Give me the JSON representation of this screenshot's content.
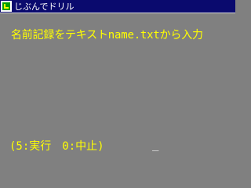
{
  "window": {
    "title": "じぶんでドリル"
  },
  "icons": {
    "app": "app-logo-icon"
  },
  "colors": {
    "background": "#808080",
    "titlebar": "#0a0a6e",
    "text": "#ffff00",
    "cursor": "#ffffff"
  },
  "screen": {
    "prompt": "名前記録をテキストname.txtから入力",
    "options": "(5:実行　0:中止)",
    "cursor": "_"
  }
}
